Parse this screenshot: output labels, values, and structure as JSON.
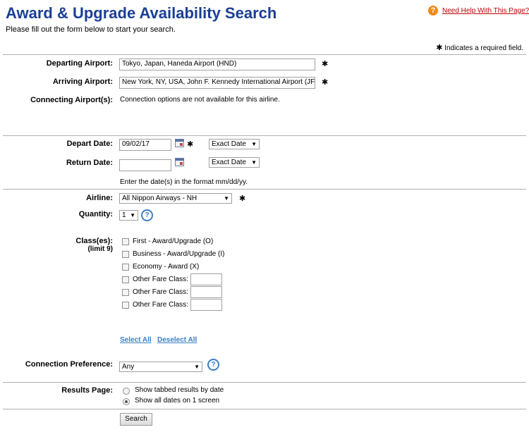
{
  "header": {
    "title": "Award & Upgrade Availability Search",
    "subtitle": "Please fill out the form below to start your search.",
    "help_link": "Need Help With This Page?",
    "help_icon": "?",
    "required_note": "Indicates a required field.",
    "required_marker": "✱"
  },
  "form": {
    "departing": {
      "label": "Departing Airport:",
      "value": "Tokyo, Japan, Haneda Airport (HND)"
    },
    "arriving": {
      "label": "Arriving Airport:",
      "value": "New York, NY, USA, John F. Kennedy International Airport (JF"
    },
    "connecting": {
      "label": "Connecting Airport(s):",
      "note": "Connection options are not available for this airline."
    },
    "depart_date": {
      "label": "Depart Date:",
      "value": "09/02/17",
      "mode": "Exact Date"
    },
    "return_date": {
      "label": "Return Date:",
      "value": "",
      "mode": "Exact Date"
    },
    "date_hint": "Enter the date(s) in the format mm/dd/yy.",
    "airline": {
      "label": "Airline:",
      "value": "All Nippon Airways - NH"
    },
    "quantity": {
      "label": "Quantity:",
      "value": "1"
    },
    "classes": {
      "label": "Class(es):",
      "limit": "(limit 9)",
      "options": [
        {
          "label": "First - Award/Upgrade (O)",
          "checked": false
        },
        {
          "label": "Business - Award/Upgrade (I)",
          "checked": false
        },
        {
          "label": "Economy - Award (X)",
          "checked": false
        },
        {
          "label": "Other Fare Class:",
          "checked": false
        },
        {
          "label": "Other Fare Class:",
          "checked": false
        },
        {
          "label": "Other Fare Class:",
          "checked": false
        }
      ],
      "select_all": "Select All",
      "deselect_all": "Deselect All"
    },
    "connection_pref": {
      "label": "Connection Preference:",
      "value": "Any"
    },
    "results_page": {
      "label": "Results Page:",
      "options": [
        {
          "label": "Show tabbed results by date",
          "selected": false
        },
        {
          "label": "Show all dates on 1 screen",
          "selected": true
        }
      ]
    },
    "search_button": "Search"
  },
  "icons": {
    "help": "help-icon",
    "calendar": "calendar-icon",
    "question": "question-circle-icon",
    "dropdown": "chevron-down-icon"
  },
  "colors": {
    "title": "#1b3f95",
    "help_link": "#c00000",
    "help_icon": "#f08a1a",
    "link": "#3b7fc4"
  }
}
